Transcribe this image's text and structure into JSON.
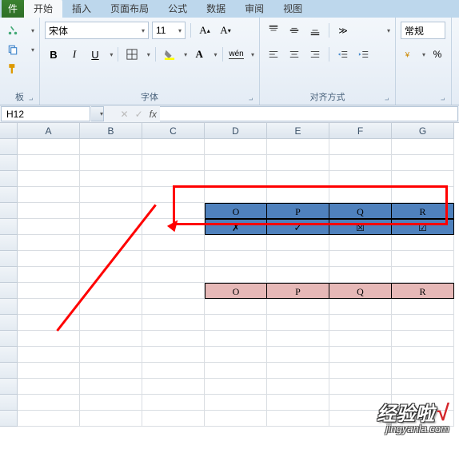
{
  "tabs": {
    "file": "件",
    "items": [
      "开始",
      "插入",
      "页面布局",
      "公式",
      "数据",
      "审阅",
      "视图"
    ],
    "active_index": 0
  },
  "ribbon": {
    "clipboard": {
      "label": "板"
    },
    "font": {
      "label": "字体",
      "name": "宋体",
      "size": "11",
      "bold": "B",
      "italic": "I",
      "underline": "U"
    },
    "align": {
      "label": "对齐方式"
    },
    "number": {
      "label": "",
      "format": "常规"
    }
  },
  "formula_bar": {
    "name_box": "H12",
    "fx": "fx",
    "value": ""
  },
  "grid": {
    "columns": [
      "A",
      "B",
      "C",
      "D",
      "E",
      "F",
      "G"
    ],
    "blue_row1": [
      "O",
      "P",
      "Q",
      "R"
    ],
    "blue_row2": [
      "✗",
      "✓",
      "☒",
      "☑"
    ],
    "pink_row": [
      "O",
      "P",
      "Q",
      "R"
    ]
  },
  "watermark": {
    "line1": "经验啦",
    "check": "√",
    "line2": "jingyanla.com"
  }
}
